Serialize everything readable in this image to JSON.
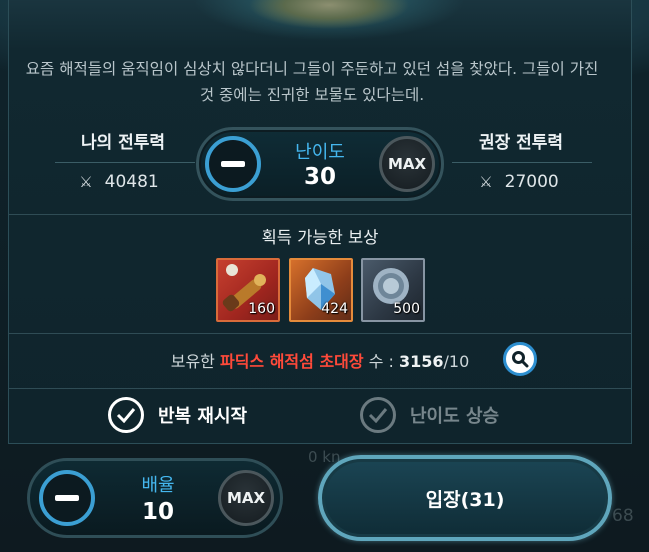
{
  "description": "요즘 해적들의 움직임이 심상치 않다더니 그들이 주둔하고 있던 섬을 찾았다. 그들이 가진 것 중에는 진귀한 보물도 있다는데.",
  "power": {
    "my_label": "나의 전투력",
    "my_value": "40481",
    "recommended_label": "권장 전투력",
    "recommended_value": "27000"
  },
  "difficulty": {
    "label": "난이도",
    "value": "30",
    "max_label": "MAX"
  },
  "rewards": {
    "title": "획득 가능한 보상",
    "items": [
      {
        "icon": "spyglass-icon",
        "qty": "160"
      },
      {
        "icon": "blue-crystal-icon",
        "qty": "424"
      },
      {
        "icon": "silver-coin-icon",
        "qty": "500"
      }
    ]
  },
  "ownership": {
    "prefix": "보유한 ",
    "item": "파딕스 해적섬 초대장",
    "suffix": " 수 : ",
    "count": "3156",
    "limit": "/10"
  },
  "options": {
    "repeat_restart": "반복 재시작",
    "difficulty_up": "난이도 상승"
  },
  "multiplier": {
    "label": "배율",
    "value": "10",
    "max_label": "MAX"
  },
  "enter_button": "입장(31)",
  "background": {
    "distance": "0 kn",
    "right_number": "68"
  },
  "colors": {
    "accent_blue": "#45b7ef",
    "highlight_red": "#ff4a3a",
    "panel": "#0f242c"
  }
}
